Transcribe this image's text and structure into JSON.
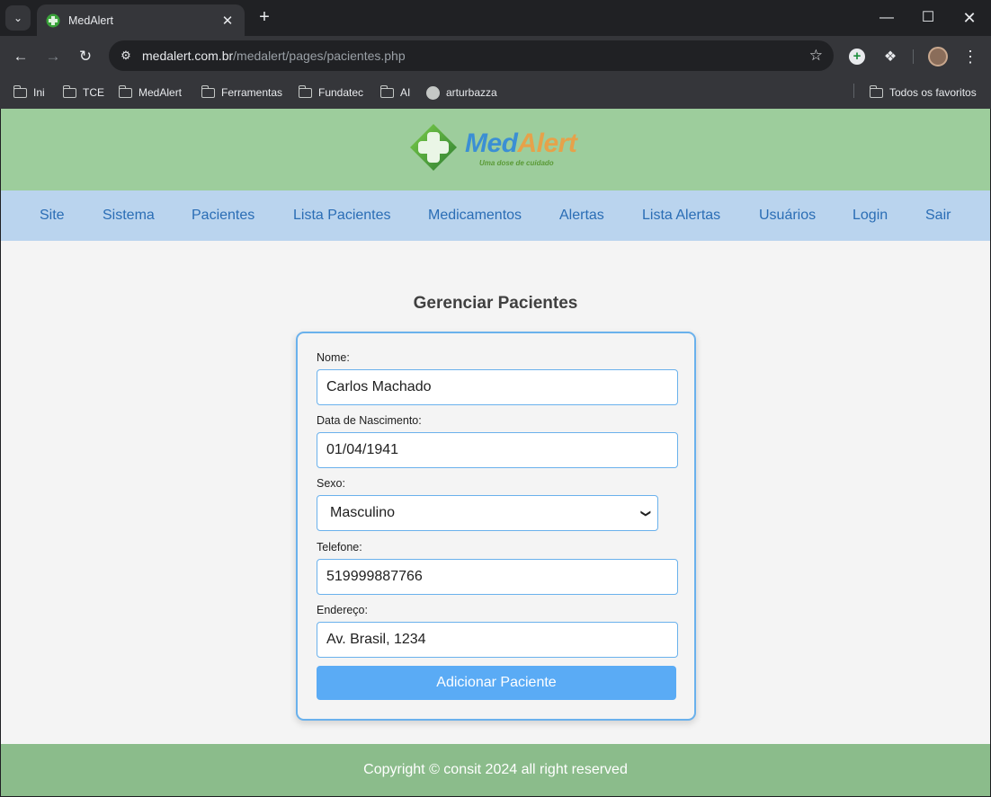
{
  "browser": {
    "tab_title": "MedAlert",
    "url_host": "medalert.com.br",
    "url_path": "/medalert/pages/pacientes.php",
    "bookmarks": [
      "Ini",
      "TCE",
      "MedAlert",
      "Ferramentas",
      "Fundatec",
      "AI",
      "arturbazza"
    ],
    "all_bookmarks_label": "Todos os favoritos"
  },
  "site": {
    "logo_name_part1": "Med",
    "logo_name_part2": "Alert",
    "logo_tagline": "Uma dose de cuidado",
    "nav": [
      "Site",
      "Sistema",
      "Pacientes",
      "Lista Pacientes",
      "Medicamentos",
      "Alertas",
      "Lista Alertas",
      "Usuários",
      "Login",
      "Sair"
    ],
    "page_title": "Gerenciar Pacientes",
    "form": {
      "nome_label": "Nome:",
      "nome_value": "Carlos Machado",
      "nascimento_label": "Data de Nascimento:",
      "nascimento_value": "01/04/1941",
      "sexo_label": "Sexo:",
      "sexo_value": "Masculino",
      "telefone_label": "Telefone:",
      "telefone_value": "519999887766",
      "endereco_label": "Endereço:",
      "endereco_value": "Av. Brasil, 1234",
      "submit_label": "Adicionar Paciente"
    },
    "footer_text": "Copyright © consit 2024 all right reserved"
  },
  "colors": {
    "header_bg": "#9dcd9c",
    "nav_bg": "#bad4ee",
    "nav_link": "#2a6db5",
    "accent": "#5aabf5",
    "footer_bg": "#8bbc8b"
  },
  "icons": [
    "tab-list-icon",
    "medalert-favicon",
    "close-icon",
    "plus-icon",
    "minimize-icon",
    "maximize-icon",
    "window-close-icon",
    "back-icon",
    "forward-icon",
    "reload-icon",
    "site-info-icon",
    "star-icon",
    "extension-add-icon",
    "puzzle-icon",
    "profile-avatar",
    "kebab-menu-icon",
    "folder-icon",
    "github-icon",
    "chevron-down-icon"
  ]
}
